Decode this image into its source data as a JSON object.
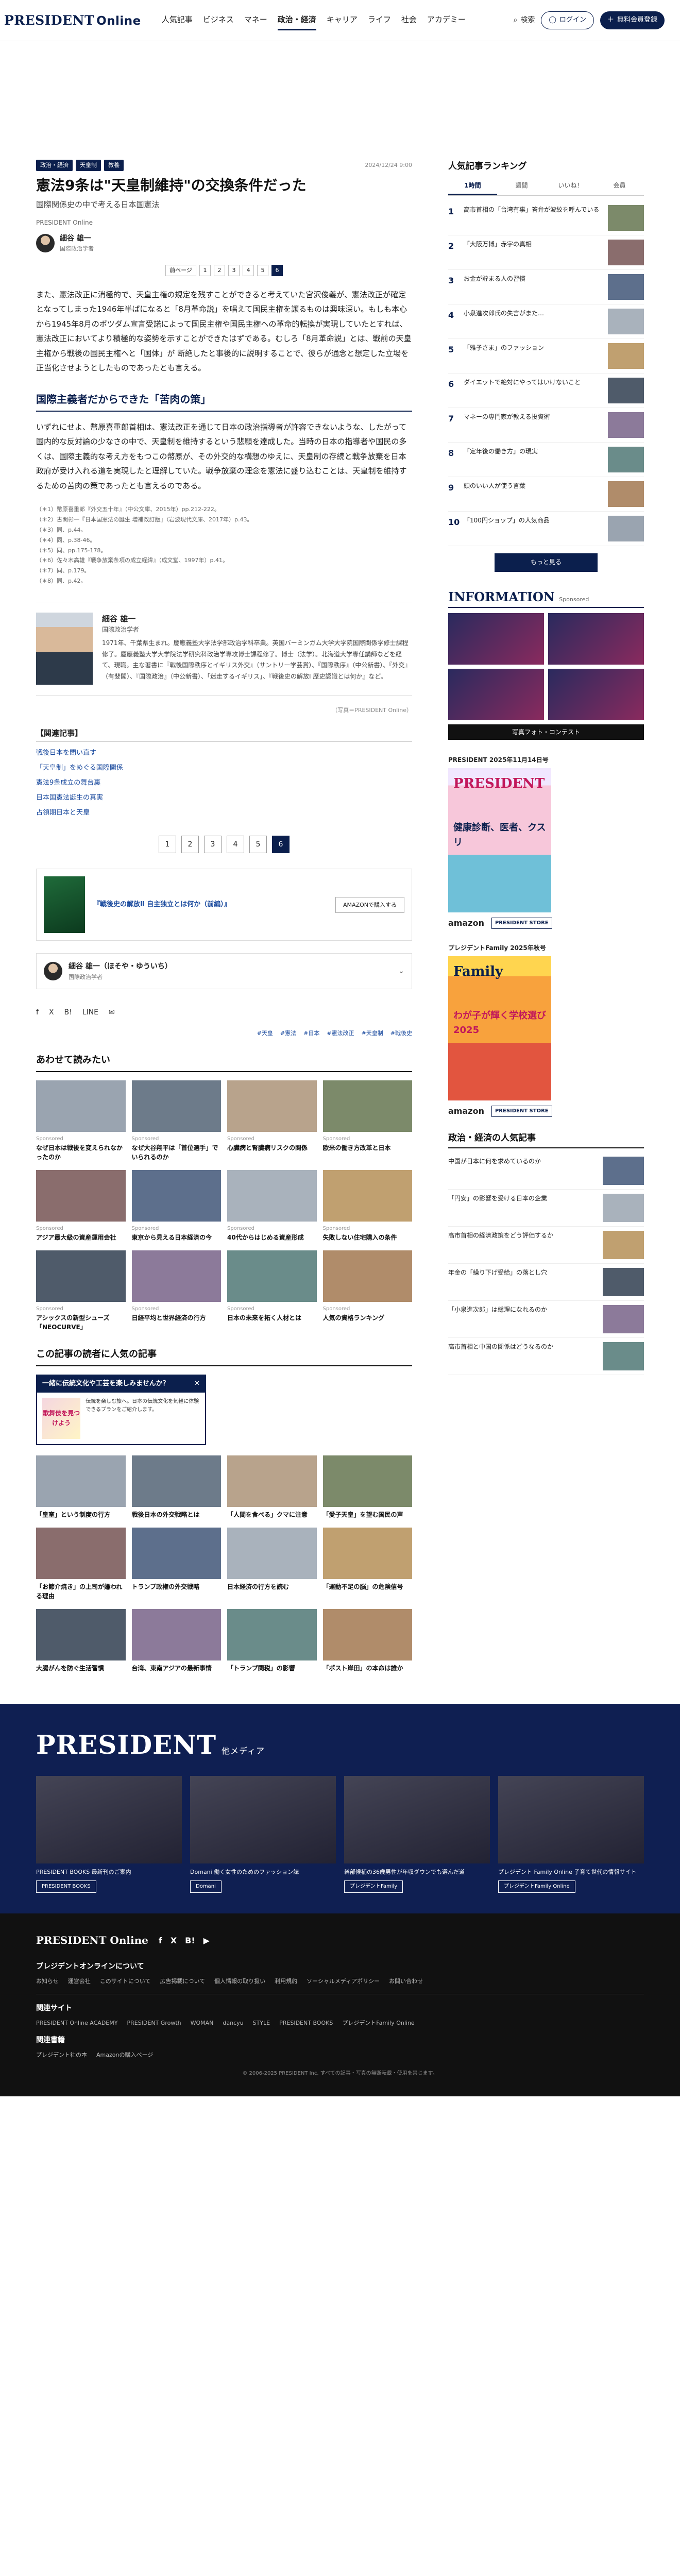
{
  "header": {
    "logo": "PRESIDENT",
    "logo_suffix": "Online",
    "nav": [
      "人気記事",
      "ビジネス",
      "マネー",
      "政治・経済",
      "キャリア",
      "ライフ",
      "社会",
      "アカデミー"
    ],
    "nav_active_index": 3,
    "search_label": "検索",
    "login_label": "ログイン",
    "member_label": "無料会員登録"
  },
  "article": {
    "tags": [
      "政治・経済",
      "天皇制",
      "教養"
    ],
    "date": "2024/12/24 9:00",
    "title": "憲法9条は\"天皇制維持\"の交換条件だった",
    "subtitle": "国際関係史の中で考える日本国憲法",
    "credit": "PRESIDENT Online",
    "author_name": "細谷 雄一",
    "author_role": "国際政治学者",
    "pager_top": [
      "前ページ",
      "1",
      "2",
      "3",
      "4",
      "5",
      "6"
    ],
    "pager_top_current": 6,
    "paragraph1": "また、憲法改正に消極的で、天皇主権の規定を残すことができると考えていた宮沢俊義が、憲法改正が確定となってしまった1946年半ばになると「8月革命説」を唱えて国民主権を譲るものは興味深い。もしも本心から1945年8月のポツダム宣言受諾によって国民主権や国民主権への革命的転換が実現していたとすれば、憲法改正においてより積極的な姿勢を示すことができたはずである。むしろ「8月革命説」とは、戦前の天皇主権から戦後の国民主権へと「国体」が 断絶したと事後的に説明することで、彼らが通念と想定した立場を正当化させようとしたものであったとも言える。",
    "section_heading": "国際主義者だからできた「苦肉の策」",
    "paragraph2": "いずれにせよ、幣原喜重郎首相は、憲法改正を通じて日本の政治指導者が許容できないような、したがって国内的な反対論の少なさの中で、天皇制を維持するという悲願を達成した。当時の日本の指導者や国民の多くは、国際主義的な考え方をもつこの幣原が、その外交的な構想のゆえに、天皇制の存続と戦争放棄を日本政府が受け入れる道を実現したと理解していた。戦争放棄の理念を憲法に盛り込むことは、天皇制を維持するための苦肉の策であったとも言えるのである。",
    "notes": [
      "（＊1）幣原喜重郎『外交五十年』（中公文庫、2015年）pp.212-222。",
      "（＊2）古関彰一『日本国憲法の誕生 増補改訂版』（岩波現代文庫、2017年）p.43。",
      "（＊3）同、p.44。",
      "（＊4）同、p.38-46。",
      "（＊5）同、pp.175-178。",
      "（＊6）佐々木高雄『戦争放棄条項の成立経緯』（成文堂、1997年）p.41。",
      "（＊7）同、p.179。",
      "（＊8）同、p.42。"
    ],
    "bio": "1971年、千葉県生まれ。慶應義塾大学法学部政治学科卒業。英国バーミンガム大学大学院国際関係学修士課程修了。慶應義塾大学大学院法学研究科政治学専攻博士課程修了。博士（法学）。北海道大学専任講師などを経て、現職。主な著書に『戦後国際秩序とイギリス外交』（サントリー学芸賞）、『国際秩序』（中公新書）、『外交』（有斐閣）、『国際政治』（中公新書）、「迷走するイギリス」、『戦後史の解放Ⅰ 歴史認識とは何か』など。",
    "photo_credit": "（写真＝PRESIDENT Online）",
    "related_title": "【関連記事】",
    "related": [
      "戦後日本を問い直す",
      "「天皇制」をめぐる国際関係",
      "憲法9条成立の舞台裏",
      "日本国憲法誕生の真実",
      "占領期日本と天皇"
    ],
    "pager_bottom": [
      "1",
      "2",
      "3",
      "4",
      "5",
      "6"
    ],
    "pager_bottom_current": 6,
    "book_title": "『戦後史の解放Ⅱ 自主独立とは何か（前編）』",
    "book_button": "AMAZONで購入する",
    "author_strip_name": "細谷 雄一（ほそや・ゆういち）",
    "author_strip_role": "国際政治学者",
    "share": [
      "f",
      "X",
      "B!",
      "LINE",
      "✉"
    ],
    "keywords": [
      "#天皇",
      "#憲法",
      "#日本",
      "#憲法改正",
      "#天皇制",
      "#戦後史"
    ]
  },
  "recommend": {
    "title": "あわせて読みたい",
    "cards": [
      {
        "cap": "Sponsored",
        "title": "なぜ日本は戦後を変えられなかったのか"
      },
      {
        "cap": "Sponsored",
        "title": "なぜ大谷翔平は「首位選手」でいられるのか"
      },
      {
        "cap": "Sponsored",
        "title": "心臓病と腎臓病リスクの関係"
      },
      {
        "cap": "Sponsored",
        "title": "欧米の働き方改革と日本"
      },
      {
        "cap": "Sponsored",
        "title": "アジア最大級の資産運用会社"
      },
      {
        "cap": "Sponsored",
        "title": "東京から見える日本経済の今"
      },
      {
        "cap": "Sponsored",
        "title": "40代からはじめる資産形成"
      },
      {
        "cap": "Sponsored",
        "title": "失敗しない住宅購入の条件"
      },
      {
        "cap": "Sponsored",
        "title": "アシックスの新型シューズ「NEOCURVE」"
      },
      {
        "cap": "Sponsored",
        "title": "日経平均と世界経済の行方"
      },
      {
        "cap": "Sponsored",
        "title": "日本の未来を拓く人材とは"
      },
      {
        "cap": "Sponsored",
        "title": "人気の資格ランキング"
      }
    ]
  },
  "popup": {
    "head": "一緒に伝統文化や工芸を楽しみませんか？",
    "img_text": "歌舞伎を見つけよう",
    "body": "伝統を楽しむ旅へ。日本の伝統文化を気軽に体験できるプランをご紹介します。"
  },
  "reader_picks": {
    "title": "この記事の読者に人気の記事",
    "cards": [
      {
        "cap": "",
        "title": "「皇室」という制度の行方"
      },
      {
        "cap": "",
        "title": "戦後日本の外交戦略とは"
      },
      {
        "cap": "",
        "title": "「人間を食べる」クマに注意"
      },
      {
        "cap": "",
        "title": "「愛子天皇」を望む国民の声"
      },
      {
        "cap": "",
        "title": "「お節介焼き」の上司が嫌われる理由"
      },
      {
        "cap": "",
        "title": "トランプ政権の外交戦略"
      },
      {
        "cap": "",
        "title": "日本経済の行方を読む"
      },
      {
        "cap": "",
        "title": "「運動不足の脳」の危険信号"
      },
      {
        "cap": "",
        "title": "大腸がんを防ぐ生活習慣"
      },
      {
        "cap": "",
        "title": "台湾、東南アジアの最新事情"
      },
      {
        "cap": "",
        "title": "「トランプ関税」の影響"
      },
      {
        "cap": "",
        "title": "「ポスト岸田」の本命は誰か"
      }
    ]
  },
  "sidebar": {
    "ranking_title": "人気記事ランキング",
    "tabs": [
      "1時間",
      "週間",
      "いいね！",
      "会員"
    ],
    "tab_active": 0,
    "ranking": [
      "高市首相の「台湾有事」答弁が波紋を呼んでいる",
      "「大阪万博」赤字の真相",
      "お金が貯まる人の習慣",
      "小泉進次郎氏の失言がまた…",
      "「雅子さま」のファッション",
      "ダイエットで絶対にやってはいけないこと",
      "マネーの専門家が教える投資術",
      "「定年後の働き方」の現実",
      "頭のいい人が使う言葉",
      "「100円ショップ」の人気商品"
    ],
    "more": "もっと見る",
    "info_title": "INFORMATION",
    "info_sponsored": "Sponsored",
    "info_wide": "写真フォト・コンテスト",
    "mag1_head": "PRESIDENT 2025年11月14日号",
    "mag1_name": "PRESIDENT",
    "mag1_cover": "健康診断、医者、クスリ",
    "mag2_head": "プレジデントFamily 2025年秋号",
    "mag2_name": "Family",
    "mag2_cover": "わが子が輝く学校選び2025",
    "buy_amazon": "amazon",
    "buy_store": "PRESIDENT STORE",
    "pol_title": "政治・経済の人気記事",
    "pol": [
      "中国が日本に何を求めているのか",
      "「円安」の影響を受ける日本の企業",
      "高市首相の経済政策をどう評価するか",
      "年金の「繰り下げ受給」の落とし穴",
      "「小泉進次郎」は総理になれるのか",
      "高市首相と中国の関係はどうなるのか"
    ]
  },
  "footer": {
    "band_logo": "PRESIDENT",
    "band_suffix": "他メディア",
    "band_cards": [
      {
        "text": "PRESIDENT BOOKS 最新刊のご案内",
        "btn": "PRESIDENT BOOKS"
      },
      {
        "text": "Domani 働く女性のためのファッション誌",
        "btn": "Domani"
      },
      {
        "text": "幹部候補の36歳男性が年収ダウンでも選んだ道",
        "btn": "プレジデントFamily"
      },
      {
        "text": "プレジデント Family Online 子育て世代の情報サイト",
        "btn": "プレジデントFamily Online"
      }
    ],
    "logo": "PRESIDENT Online",
    "about": "プレジデントオンラインについて",
    "about_links": [
      "お知らせ",
      "運営会社",
      "このサイトについて",
      "広告掲載について",
      "個人情報の取り扱い",
      "利用規約",
      "ソーシャルメディアポリシー",
      "お問い合わせ"
    ],
    "related_sites": "関連サイト",
    "related_links": [
      "PRESIDENT Online ACADEMY",
      "PRESIDENT Growth",
      "WOMAN",
      "dancyu",
      "STYLE",
      "PRESIDENT BOOKS",
      "プレジデントFamily Online"
    ],
    "books_head": "関連書籍",
    "books_links": [
      "プレジデント社の本",
      "Amazonの購入ページ"
    ],
    "copyright": "© 2006-2025 PRESIDENT Inc. すべての記事・写真の無断転載・使用を禁じます。"
  }
}
